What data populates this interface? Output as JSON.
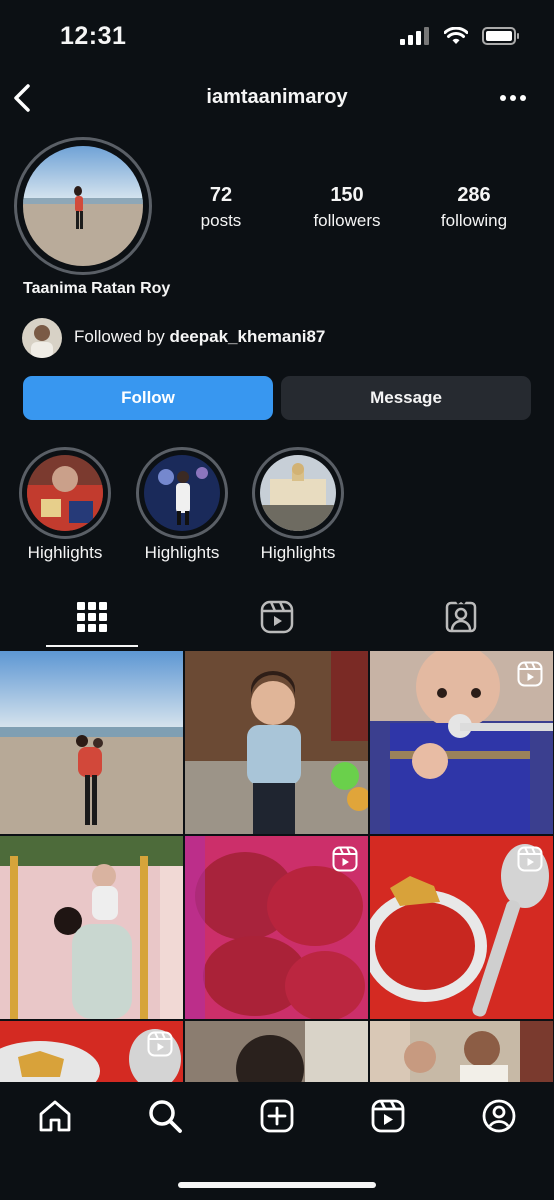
{
  "status_bar": {
    "time": "12:31"
  },
  "header": {
    "username": "iamtaanimaroy"
  },
  "profile": {
    "display_name": "Taanima Ratan Roy",
    "stats": [
      {
        "value": "72",
        "label": "posts"
      },
      {
        "value": "150",
        "label": "followers"
      },
      {
        "value": "286",
        "label": "following"
      }
    ],
    "followed_by_prefix": "Followed by",
    "followed_by_user": "deepak_khemani87"
  },
  "actions": {
    "follow_label": "Follow",
    "message_label": "Message"
  },
  "highlights": [
    {
      "label": "Highlights"
    },
    {
      "label": "Highlights"
    },
    {
      "label": "Highlights"
    }
  ],
  "tabs": [
    {
      "icon": "grid-icon",
      "active": true
    },
    {
      "icon": "reels-icon",
      "active": false
    },
    {
      "icon": "tagged-icon",
      "active": false
    }
  ],
  "bottom_nav": [
    "home-icon",
    "search-icon",
    "create-icon",
    "reels-icon",
    "profile-icon"
  ],
  "colors": {
    "background": "#0c1014",
    "follow_button": "#3897f0",
    "message_button": "#262a30"
  }
}
